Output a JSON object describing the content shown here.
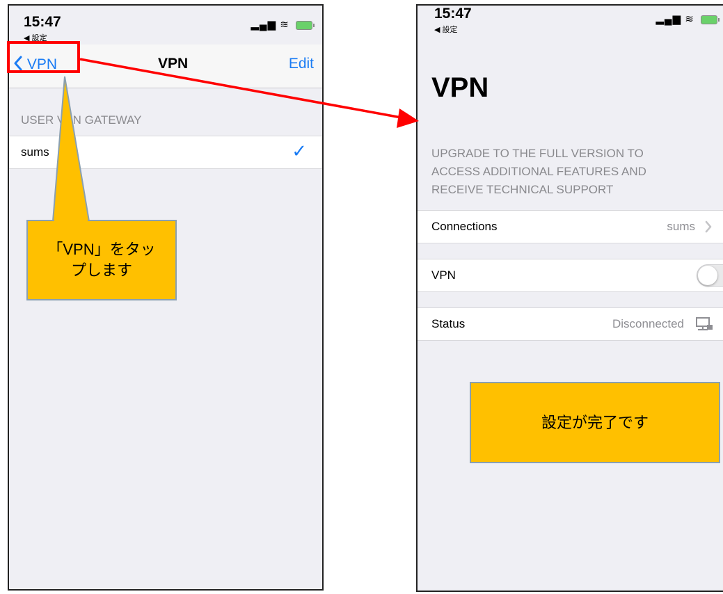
{
  "left_screen": {
    "status": {
      "time": "15:47",
      "back_app": "◀ 設定"
    },
    "nav": {
      "back_label": "VPN",
      "title": "VPN",
      "edit_label": "Edit"
    },
    "section_header": "USER VPN GATEWAY",
    "gateways": [
      {
        "name": "sums",
        "selected": true
      }
    ]
  },
  "right_screen": {
    "status": {
      "time": "15:47",
      "back_app": "◀ 設定"
    },
    "large_title": "VPN",
    "upgrade_lines": [
      "UPGRADE TO THE FULL VERSION TO",
      "ACCESS ADDITIONAL FEATURES AND",
      "RECEIVE TECHNICAL SUPPORT"
    ],
    "connections": {
      "label": "Connections",
      "value": "sums"
    },
    "vpn_toggle": {
      "label": "VPN",
      "on": false
    },
    "status_row": {
      "label": "Status",
      "value": "Disconnected"
    }
  },
  "annotations": {
    "callout_left_line1": "「VPN」をタッ",
    "callout_left_line2": "プします",
    "callout_right": "設定が完了です",
    "colors": {
      "callout": "#ffc000",
      "highlight": "#ff0000",
      "accent": "#1a7cf4"
    }
  }
}
